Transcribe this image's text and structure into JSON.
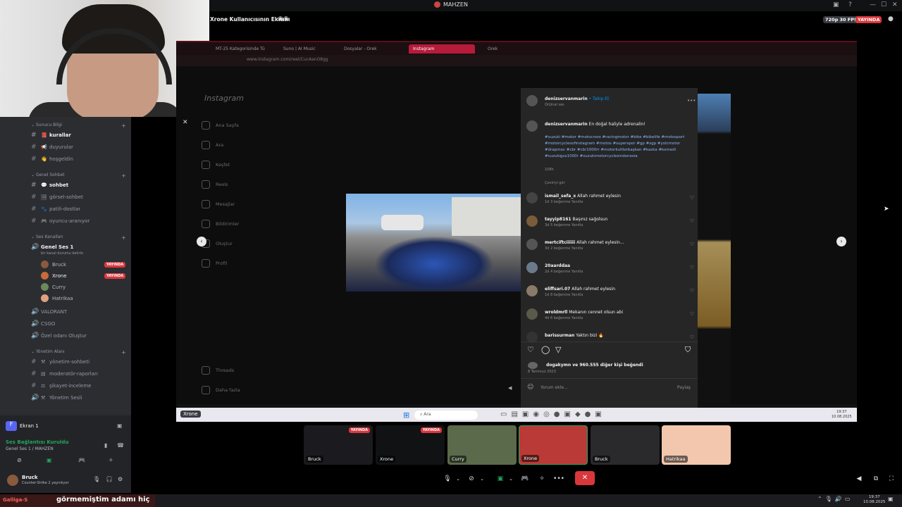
{
  "window": {
    "title": "MAHZEN",
    "controls": [
      "—",
      "☐",
      "✕"
    ]
  },
  "stream": {
    "title": "Xrone Kullanıcısının Ekranı",
    "quality": "720p 30 FPS",
    "live": "YAYINDA"
  },
  "sidebar": {
    "categories": [
      {
        "label": "Sunucu Bilgi",
        "channels": [
          {
            "emoji": "📕",
            "label": "kurallar",
            "bold": true
          },
          {
            "emoji": "📢",
            "label": "duyurular"
          },
          {
            "emoji": "👋",
            "label": "hoşgeldin"
          }
        ]
      },
      {
        "label": "Genel Sohbet",
        "channels": [
          {
            "emoji": "💬",
            "label": "sohbet",
            "bold": true
          },
          {
            "emoji": "🖼",
            "label": "görsel-sohbet"
          },
          {
            "emoji": "🐾",
            "label": "patili-dostlar"
          },
          {
            "emoji": "🎮",
            "label": "oyuncu-aranıyor"
          }
        ]
      },
      {
        "label": "Ses Kanalları"
      }
    ],
    "voice_channel": {
      "label": "Genel Ses 1",
      "subtitle": "bir kanal durumu belirle"
    },
    "voice_users": [
      {
        "name": "Bruck",
        "live": "YAYINDA",
        "color": "#8a5a3c"
      },
      {
        "name": "Xrone",
        "live": "YAYINDA",
        "color": "#c86a3a"
      },
      {
        "name": "Curry",
        "color": "#6a8a5a"
      },
      {
        "name": "Hatrikaa",
        "color": "#e0a080"
      }
    ],
    "other_voice": [
      "VALORANT",
      "CSGO",
      "Özel odanı Oluştur"
    ],
    "admin_category": "Yönetim Alanı",
    "admin_channels": [
      "yönetim-sohbeti",
      "moderatör-raporları",
      "şikayet-inceleme",
      "Yönetim Sesli"
    ]
  },
  "user_panel": {
    "screen_label": "Ekran 1",
    "connection": "Ses Bağlantısı Kuruldu",
    "channel": "Genel Ses 1 / MAHZEN",
    "username": "Bruck",
    "status": "Counter-Strike 2 yayınlıyor"
  },
  "browser": {
    "tabs": [
      "MT-25 Kategorisinde Tü",
      "Suno | AI Music",
      "Dosyalar - Orek",
      "Instagram",
      "Orek"
    ],
    "url": "www.instagram.com/reel/CucAanO8gg"
  },
  "instagram": {
    "logo": "Instagram",
    "nav": [
      "Ana Sayfa",
      "Ara",
      "Keşfet",
      "Reels",
      "Mesajlar",
      "Bildirimler",
      "Oluştur",
      "Profil",
      "Threads",
      "Daha fazla"
    ],
    "author": "denizservanmarin",
    "follow": "• Takip Et",
    "audio": "Orijinal ses",
    "caption": "En doğal haliyle adrenalin!",
    "hashtags": "#suzuki #motor #motocross #racingmotor #bike #bikelife #motosport #motorcyclesofinstagram #motos #superspor #gp #sgp #yolcmotor #drapmoc #cbr #cbr1000rr #motorkultlerbaşkan #kaska #komedi #suzukigsx1000r #suzukimotorcyclesindonesia",
    "caption_time": "108h",
    "see_translation": "Çeviriyi gör",
    "comments": [
      {
        "user": "ismail_sefa_x",
        "text": "Allah rahmet eylesin",
        "meta": "1d   3 beğenme   Yanıtla"
      },
      {
        "user": "tayyip8161",
        "text": "Başınız sağolsun",
        "meta": "3d   5 beğenme   Yanıtla"
      },
      {
        "user": "mertciftciiiiii",
        "text": "Allah rahmet eylesin...",
        "meta": "3d   2 beğenme   Yanıtla"
      },
      {
        "user": "20aarddaa",
        "text": "",
        "meta": "2d   4 beğenme   Yanıtla"
      },
      {
        "user": "eliffsari.07",
        "text": "Allah rahmet eylesin",
        "meta": "1d   8 beğenme   Yanıtla"
      },
      {
        "user": "wroldmrll",
        "text": "Mekanın cennet olsun abi",
        "meta": "4d   6 beğenme   Yanıtla"
      },
      {
        "user": "barissurman",
        "text": "Yaktın bizi 🔥",
        "meta": ""
      }
    ],
    "likes": "dogakymn ve 960.555 diğer kişi beğendi",
    "date": "8 Temmuz 2023",
    "comment_placeholder": "Yorum ekle...",
    "share": "Paylaş"
  },
  "windows": {
    "search": "Ara",
    "taskbar_user": "Xrone",
    "time": "19:37",
    "date": "10.08.2025"
  },
  "tiles": [
    {
      "name": "Bruck",
      "live": "YAYINDA",
      "bg": "#1b1b1f"
    },
    {
      "name": "Xrone",
      "live": "YAYINDA",
      "bg": "#111214"
    },
    {
      "name": "Curry",
      "bg": "#5a6a4a"
    },
    {
      "name": "Xrone",
      "bg": "#b93a36"
    },
    {
      "name": "Bruck",
      "bg": "#2a2a2c"
    },
    {
      "name": "Hatrikaa",
      "bg": "#f2c7ae"
    }
  ],
  "ticker": {
    "tag": "Galliga-S",
    "text": "görmemiştim adamı hiç"
  },
  "os": {
    "time": "19:37",
    "date": "10.08.2025"
  }
}
